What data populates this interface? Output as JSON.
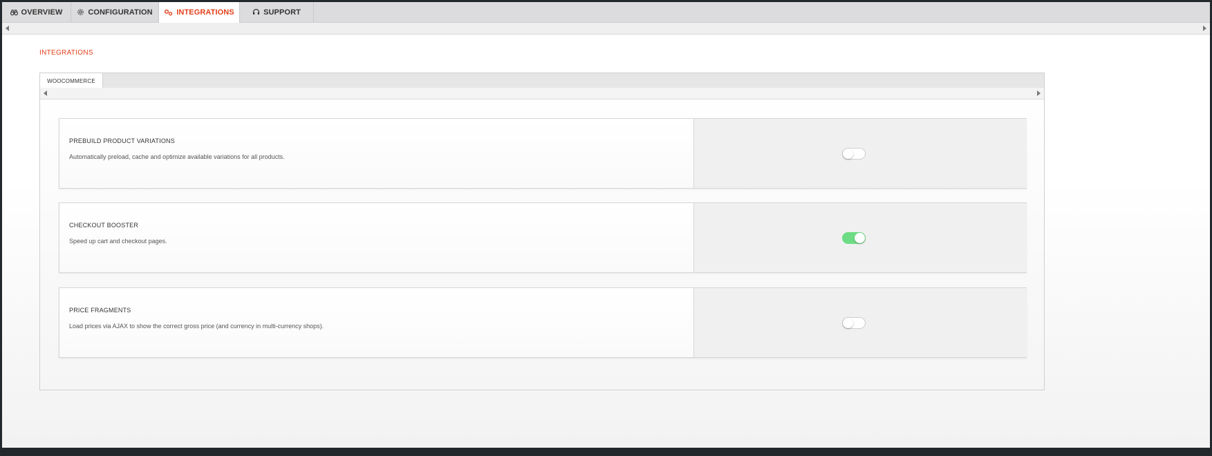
{
  "top_tabs": [
    {
      "label": "OVERVIEW",
      "icon": "binoculars-icon"
    },
    {
      "label": "CONFIGURATION",
      "icon": "gear-icon"
    },
    {
      "label": "INTEGRATIONS",
      "icon": "cogs-icon",
      "active": true
    },
    {
      "label": "SUPPORT",
      "icon": "headset-icon"
    }
  ],
  "section_title": "INTEGRATIONS",
  "inner_tab": {
    "label": "WOOCOMMERCE"
  },
  "settings": [
    {
      "name": "PREBUILD PRODUCT VARIATIONS",
      "description": "Automatically preload, cache and optimize available variations for all products.",
      "enabled": false
    },
    {
      "name": "CHECKOUT BOOSTER",
      "description": "Speed up cart and checkout pages.",
      "enabled": true
    },
    {
      "name": "PRICE FRAGMENTS",
      "description": "Load prices via AJAX to show the correct gross price (and currency in multi-currency shops).",
      "enabled": false
    }
  ],
  "colors": {
    "accent": "#e2401c",
    "toggle_on": "#6ddc84"
  }
}
